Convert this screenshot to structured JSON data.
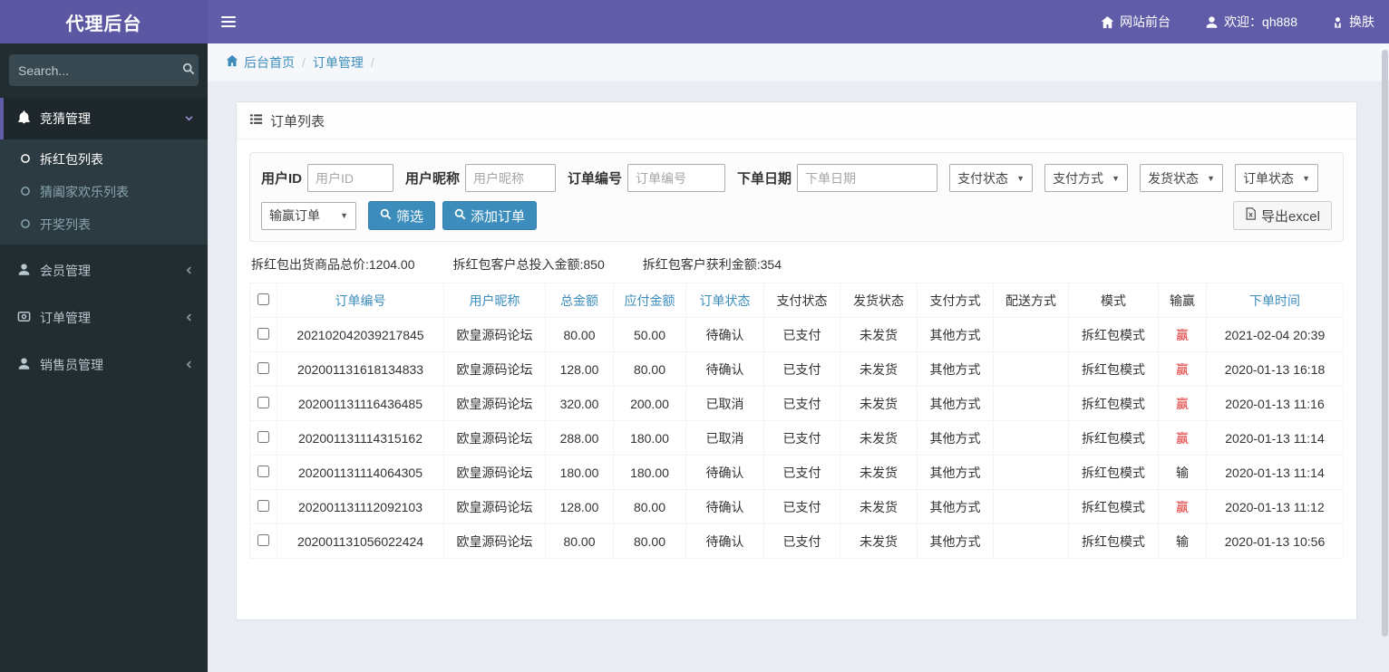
{
  "navbar": {
    "brand": "代理后台",
    "site_front": "网站前台",
    "welcome": "欢迎：qh888",
    "skin": "换肤"
  },
  "sidebar": {
    "search_placeholder": "Search...",
    "menu": [
      {
        "label": "竞猜管理"
      },
      {
        "label": "拆红包列表"
      },
      {
        "label": "猜阖家欢乐列表"
      },
      {
        "label": "开奖列表"
      },
      {
        "label": "会员管理"
      },
      {
        "label": "订单管理"
      },
      {
        "label": "销售员管理"
      }
    ]
  },
  "breadcrumb": {
    "home": "后台首页",
    "current": "订单管理",
    "sep": "/"
  },
  "panel": {
    "title": "订单列表"
  },
  "filters": {
    "fields": [
      {
        "label": "用户ID",
        "placeholder": "用户ID"
      },
      {
        "label": "用户昵称",
        "placeholder": "用户昵称"
      },
      {
        "label": "订单编号",
        "placeholder": "订单编号"
      },
      {
        "label": "下单日期",
        "placeholder": "下单日期"
      }
    ],
    "selects": [
      {
        "value": "支付状态"
      },
      {
        "value": "支付方式"
      },
      {
        "value": "发货状态"
      },
      {
        "value": "订单状态"
      },
      {
        "value": "输赢订单"
      }
    ],
    "buttons": {
      "filter": "筛选",
      "add": "添加订单",
      "export": "导出excel"
    }
  },
  "summary": [
    "拆红包出货商品总价:1204.00",
    "拆红包客户总投入金额:850",
    "拆红包客户获利金额:354"
  ],
  "table": {
    "headers": [
      "订单编号",
      "用户昵称",
      "总金额",
      "应付金额",
      "订单状态",
      "支付状态",
      "发货状态",
      "支付方式",
      "配送方式",
      "模式",
      "输赢",
      "下单时间"
    ],
    "win_value": "赢",
    "win_color": "#e03333",
    "accent_color": "#3c8dbc",
    "rows": [
      {
        "no": "202102042039217845",
        "nick": "欧皇源码论坛",
        "total": "80.00",
        "pay": "50.00",
        "ostatus": "待确认",
        "pstatus": "已支付",
        "ship": "未发货",
        "method": "其他方式",
        "delivery": "",
        "mode": "拆红包模式",
        "win": "赢",
        "time": "2021-02-04 20:39"
      },
      {
        "no": "202001131618134833",
        "nick": "欧皇源码论坛",
        "total": "128.00",
        "pay": "80.00",
        "ostatus": "待确认",
        "pstatus": "已支付",
        "ship": "未发货",
        "method": "其他方式",
        "delivery": "",
        "mode": "拆红包模式",
        "win": "赢",
        "time": "2020-01-13 16:18"
      },
      {
        "no": "202001131116436485",
        "nick": "欧皇源码论坛",
        "total": "320.00",
        "pay": "200.00",
        "ostatus": "已取消",
        "pstatus": "已支付",
        "ship": "未发货",
        "method": "其他方式",
        "delivery": "",
        "mode": "拆红包模式",
        "win": "赢",
        "time": "2020-01-13 11:16"
      },
      {
        "no": "202001131114315162",
        "nick": "欧皇源码论坛",
        "total": "288.00",
        "pay": "180.00",
        "ostatus": "已取消",
        "pstatus": "已支付",
        "ship": "未发货",
        "method": "其他方式",
        "delivery": "",
        "mode": "拆红包模式",
        "win": "赢",
        "time": "2020-01-13 11:14"
      },
      {
        "no": "202001131114064305",
        "nick": "欧皇源码论坛",
        "total": "180.00",
        "pay": "180.00",
        "ostatus": "待确认",
        "pstatus": "已支付",
        "ship": "未发货",
        "method": "其他方式",
        "delivery": "",
        "mode": "拆红包模式",
        "win": "输",
        "time": "2020-01-13 11:14"
      },
      {
        "no": "202001131112092103",
        "nick": "欧皇源码论坛",
        "total": "128.00",
        "pay": "80.00",
        "ostatus": "待确认",
        "pstatus": "已支付",
        "ship": "未发货",
        "method": "其他方式",
        "delivery": "",
        "mode": "拆红包模式",
        "win": "赢",
        "time": "2020-01-13 11:12"
      },
      {
        "no": "202001131056022424",
        "nick": "欧皇源码论坛",
        "total": "80.00",
        "pay": "80.00",
        "ostatus": "待确认",
        "pstatus": "已支付",
        "ship": "未发货",
        "method": "其他方式",
        "delivery": "",
        "mode": "拆红包模式",
        "win": "输",
        "time": "2020-01-13 10:56"
      }
    ]
  }
}
